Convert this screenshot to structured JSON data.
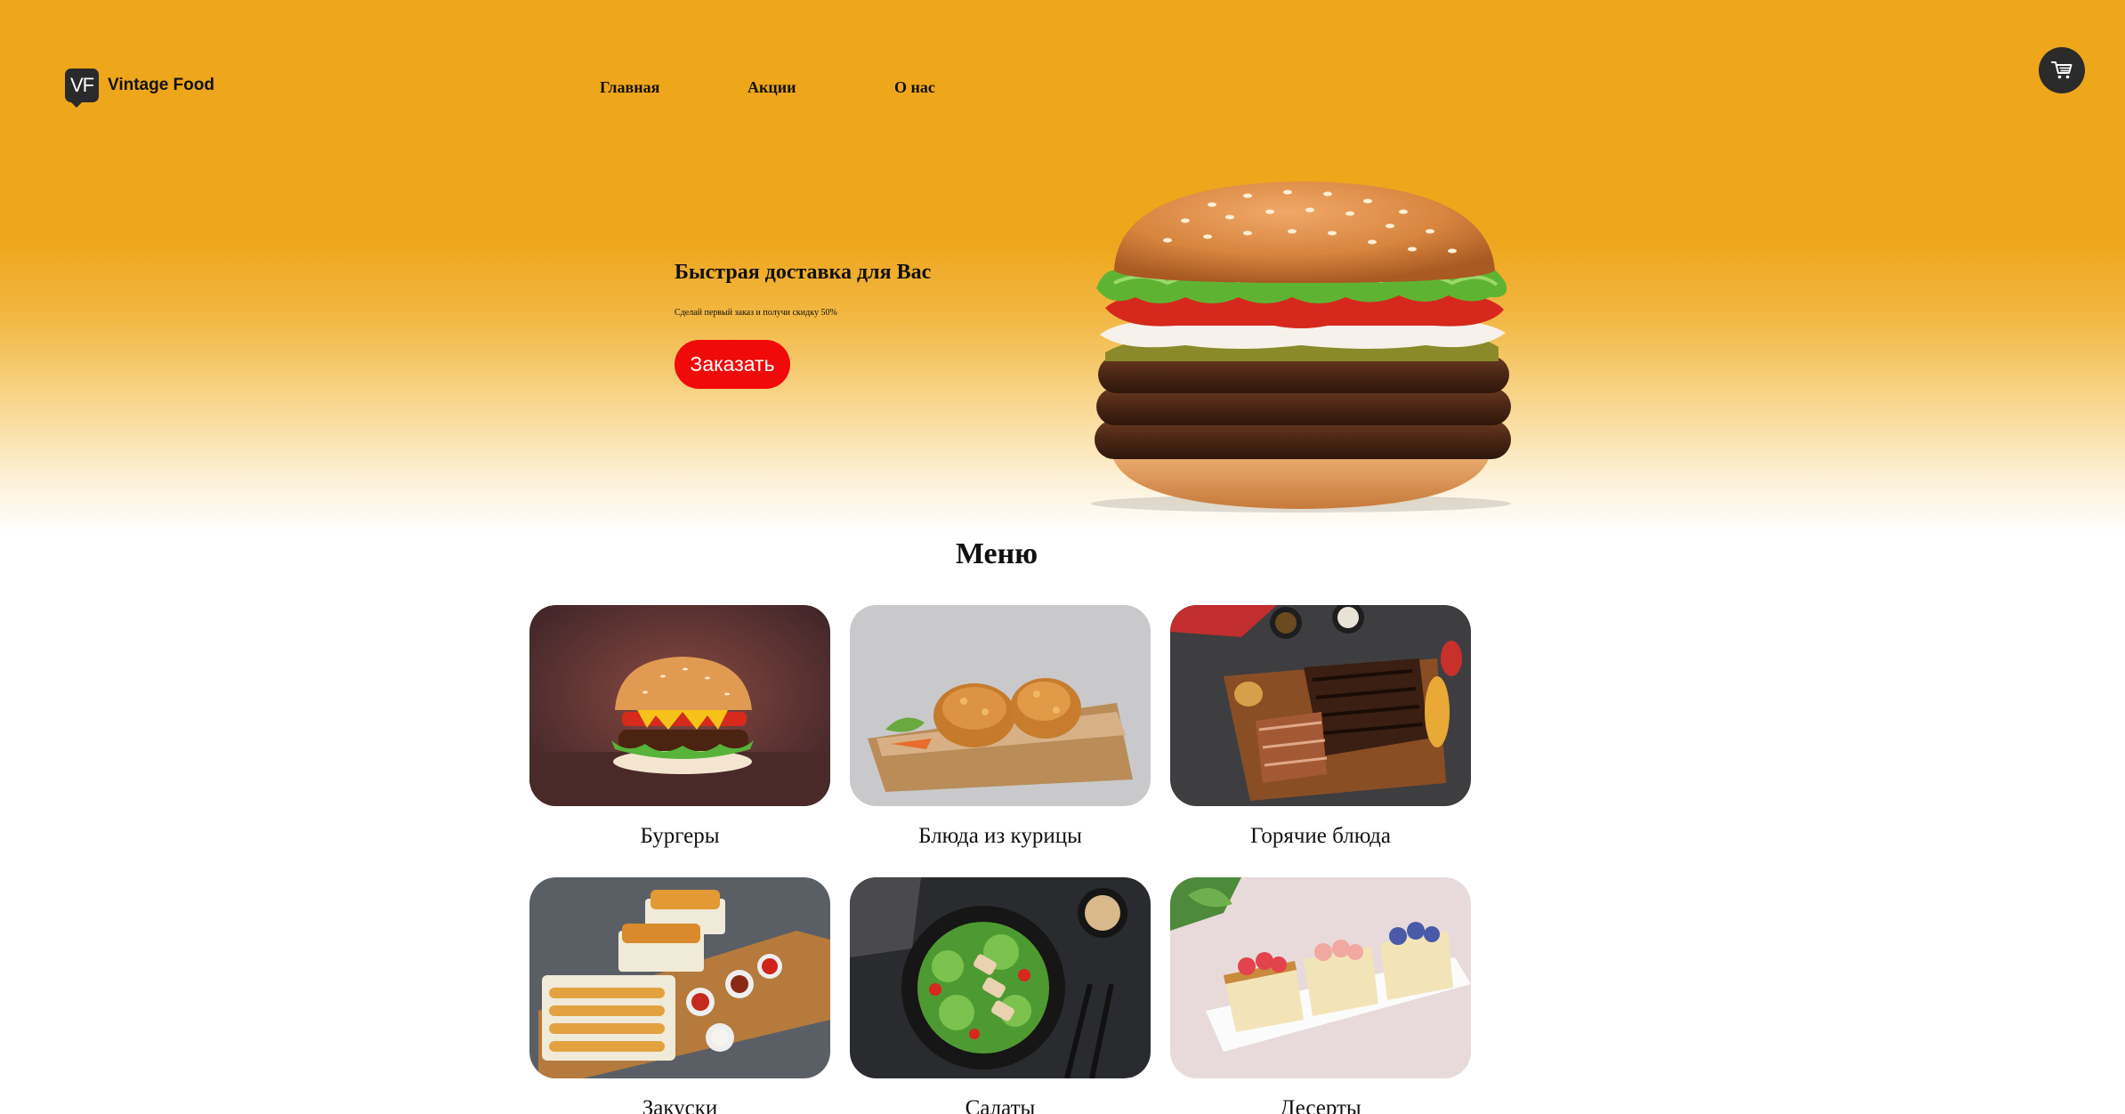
{
  "header": {
    "logo_mark": "VF",
    "logo_text": "Vintage Food",
    "nav": [
      "Главная",
      "Акции",
      "О нас"
    ],
    "cart_icon": "shopping-cart-icon"
  },
  "hero": {
    "title": "Быстрая доставка для Вас",
    "subtitle": "Сделай первый заказ и получи скидку 50%",
    "button": "Заказать",
    "button_color": "#f00a0a",
    "background_color": "#eea61b"
  },
  "menu": {
    "title": "Меню",
    "items": [
      {
        "label": "Бургеры"
      },
      {
        "label": "Блюда из курицы"
      },
      {
        "label": "Горячие блюда"
      },
      {
        "label": "Закуски"
      },
      {
        "label": "Салаты"
      },
      {
        "label": "Десерты"
      }
    ]
  }
}
